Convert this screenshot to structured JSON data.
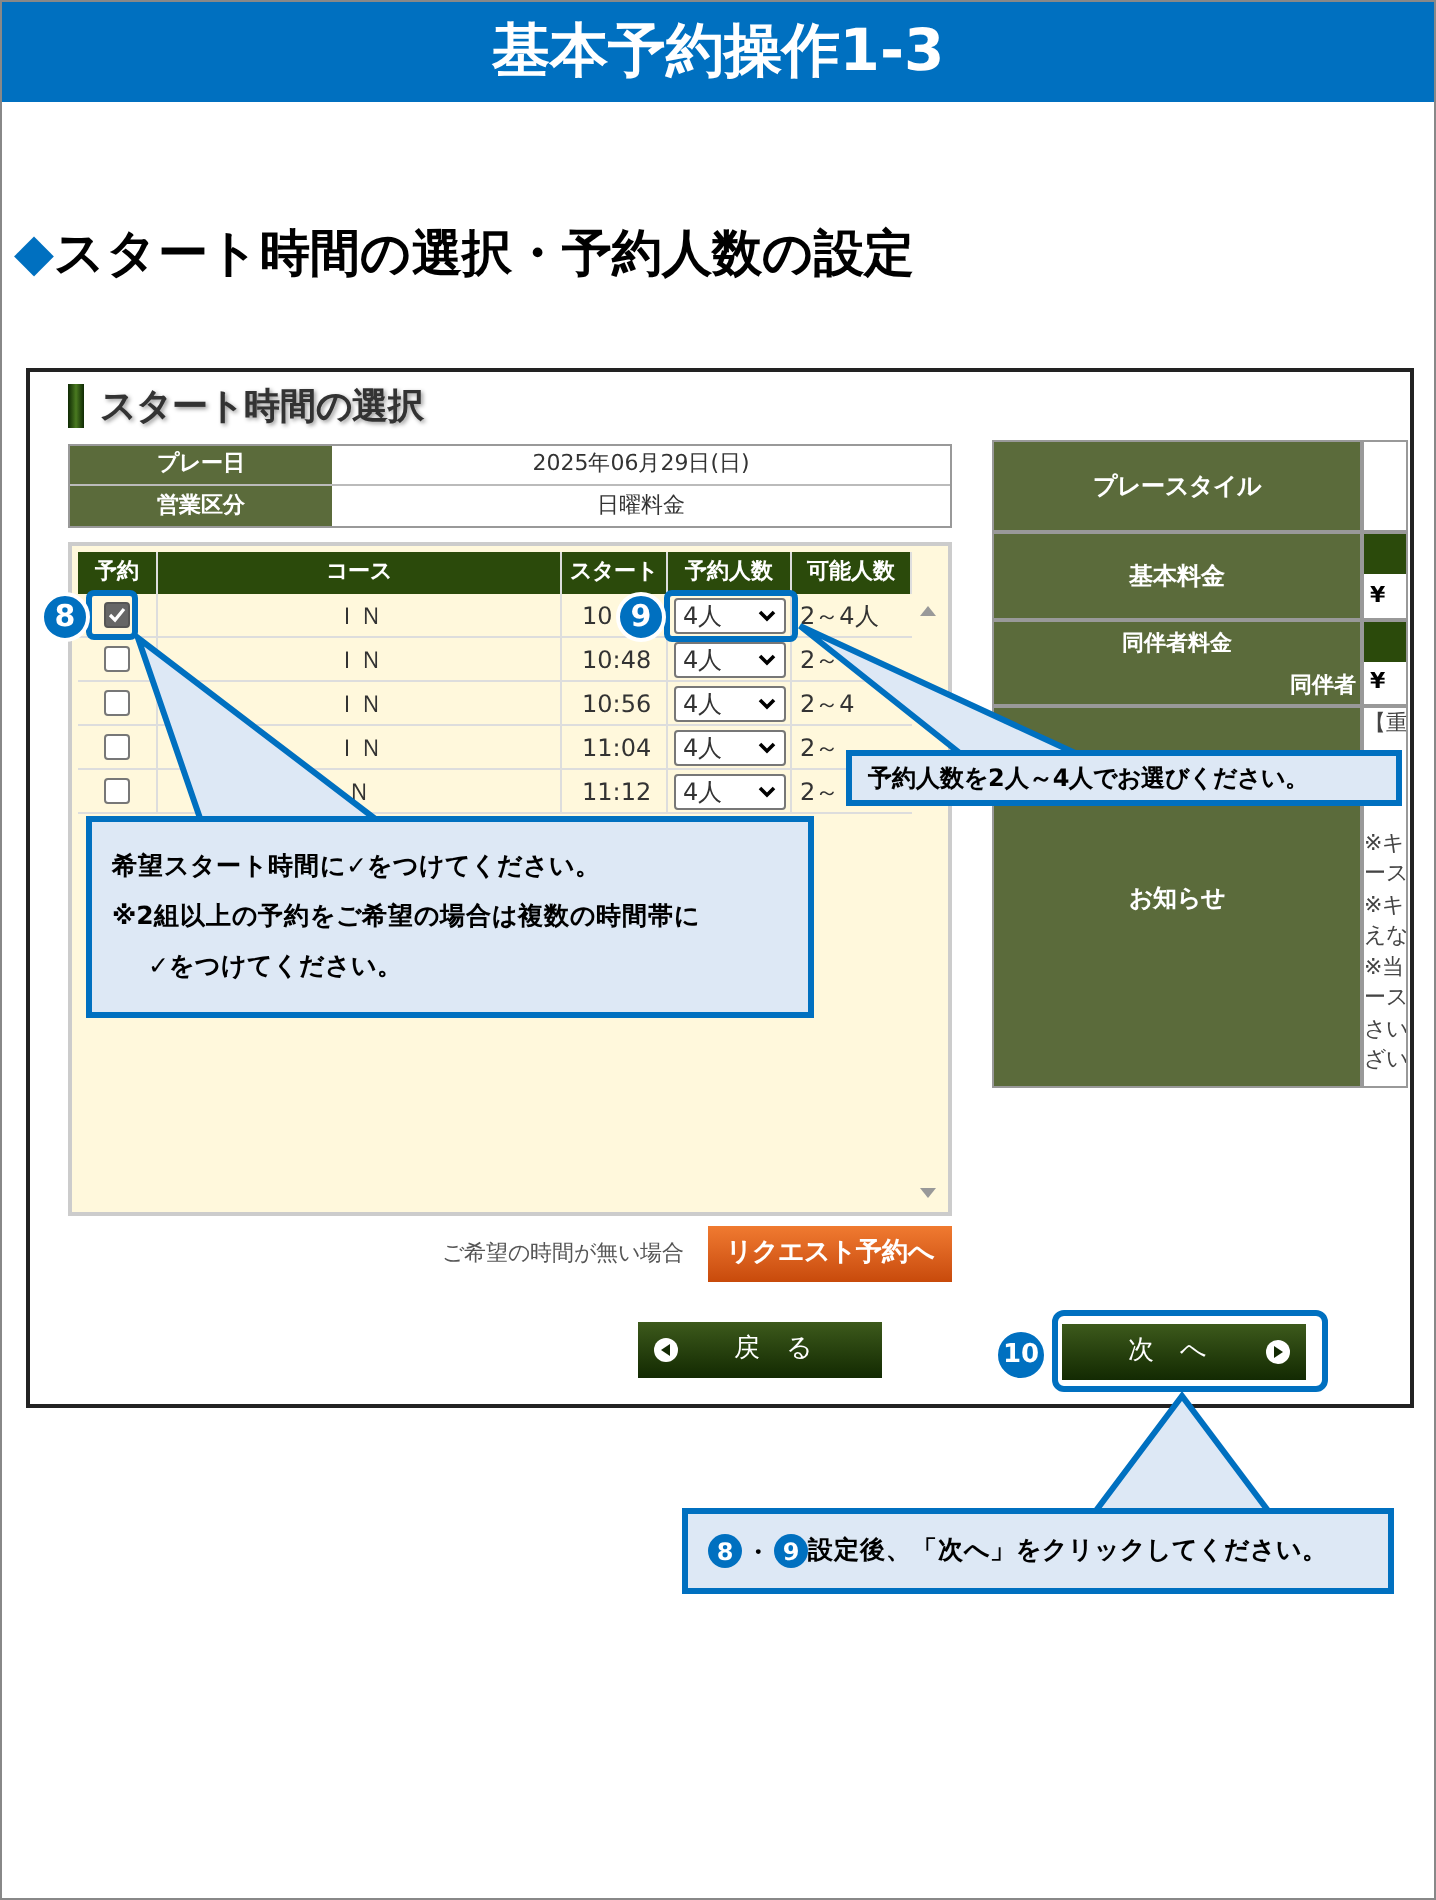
{
  "title": "基本予約操作1-3",
  "heading": {
    "marker": "◆",
    "text": "スタート時間の選択・予約人数の設定"
  },
  "screen": {
    "section_title": "スタート時間の選択",
    "info": [
      {
        "label": "プレー日",
        "value": "2025年06月29日(日)"
      },
      {
        "label": "営業区分",
        "value": "日曜料金"
      }
    ],
    "table": {
      "columns": [
        "予約",
        "コース",
        "スタート",
        "予約人数",
        "可能人数"
      ],
      "rows": [
        {
          "checked": true,
          "course": "ＩＮ",
          "start": "10",
          "party": "4人",
          "capacity": "2～4人"
        },
        {
          "checked": false,
          "course": "ＩＮ",
          "start": "10:48",
          "party": "4人",
          "capacity": "2～"
        },
        {
          "checked": false,
          "course": "ＩＮ",
          "start": "10:56",
          "party": "4人",
          "capacity": "2～4"
        },
        {
          "checked": false,
          "course": "ＩＮ",
          "start": "11:04",
          "party": "4人",
          "capacity": "2～"
        },
        {
          "checked": false,
          "course": "Ｎ",
          "start": "11:12",
          "party": "4人",
          "capacity": "2～"
        }
      ]
    },
    "request_note": "ご希望の時間が無い場合",
    "request_button": "リクエスト予約へ",
    "back_button": "戻　る",
    "next_button": "次　へ",
    "side_table": [
      {
        "kind": "plain",
        "label": "プレースタイル"
      },
      {
        "kind": "price",
        "label": "基本料金",
        "value": "¥"
      },
      {
        "kind": "companion",
        "label": "同伴者料金",
        "sublabel": "同伴者",
        "value": "¥"
      },
      {
        "kind": "notice",
        "label": "お知らせ",
        "lines": [
          "【重",
          "※キ",
          "ース",
          "※キ",
          "えな",
          "※当",
          "ース",
          "さい",
          "ざい"
        ]
      }
    ]
  },
  "callouts": {
    "badges": [
      "8",
      "9",
      "10"
    ],
    "party_tip": "予約人数を2人～4人でお選びください。",
    "check_tip": [
      {
        "text": "希望スタート時間に✓をつけてください。",
        "indent": false
      },
      {
        "text": "※2組以上の予約をご希望の場合は複数の時間帯に",
        "indent": false
      },
      {
        "text": "✓をつけてください。",
        "indent": true
      }
    ],
    "next_tip": {
      "badges": [
        "8",
        "9"
      ],
      "separator": "・",
      "text": "設定後、「次へ」をクリックしてください。"
    }
  }
}
